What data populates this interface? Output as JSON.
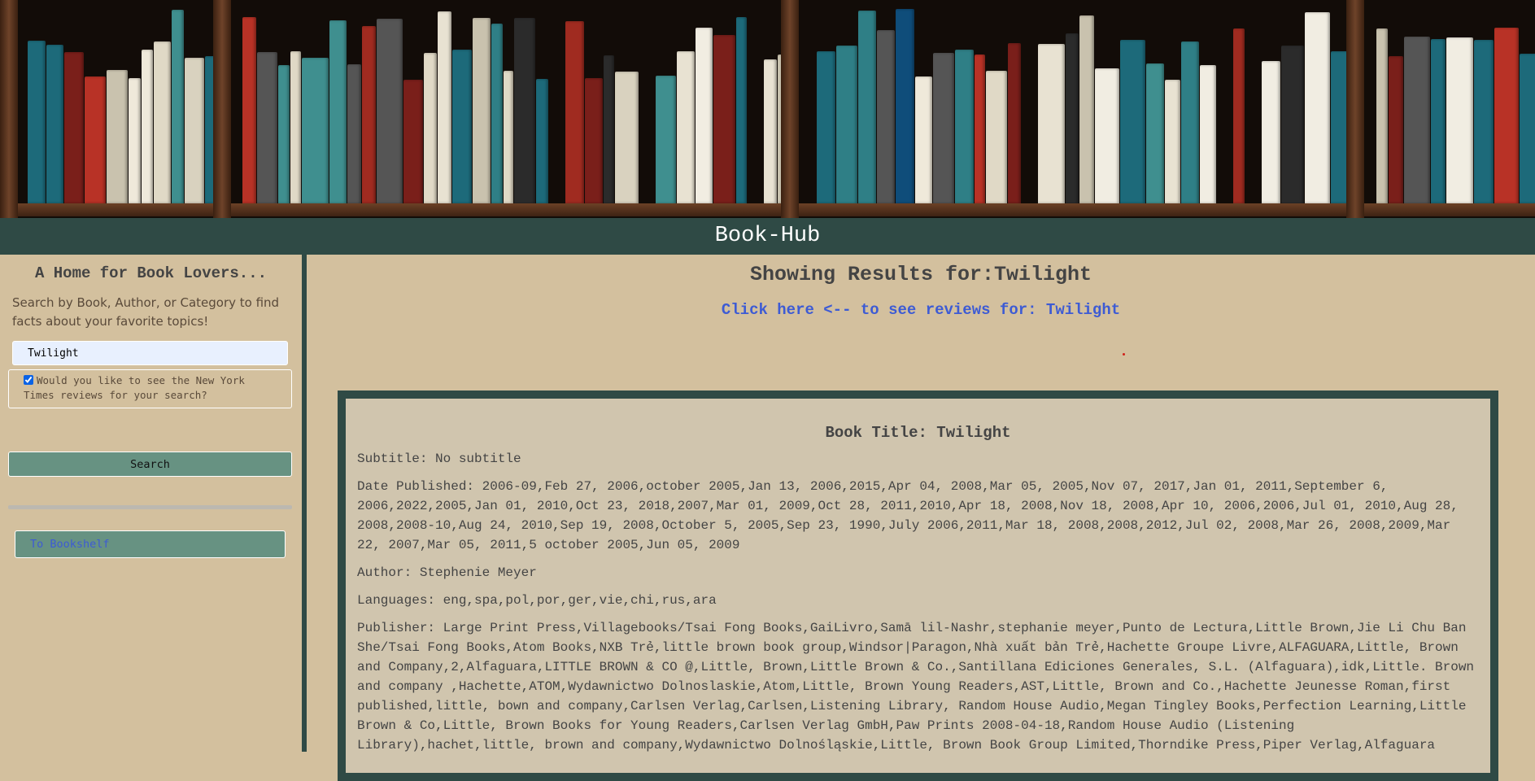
{
  "header": {
    "title": "Book-Hub"
  },
  "sidebar": {
    "heading": "A Home for Book Lovers...",
    "intro": "Search by Book, Author, or Category to find facts about your favorite topics!",
    "search_value": "Twilight",
    "nyt_checkbox_checked": true,
    "nyt_checkbox_label": "Would you like to see the New York Times reviews for your search?",
    "search_button": "Search",
    "bookshelf_link": "To Bookshelf"
  },
  "main": {
    "results_title": "Showing Results for:Twilight",
    "reviews_link": "Click here <-- to see reviews for: Twilight",
    "book": {
      "title": "Book Title: Twilight",
      "subtitle": "Subtitle: No subtitle",
      "date_published": "Date Published: 2006-09,Feb 27, 2006,october 2005,Jan 13, 2006,2015,Apr 04, 2008,Mar 05, 2005,Nov 07, 2017,Jan 01, 2011,September 6, 2006,2022,2005,Jan 01, 2010,Oct 23, 2018,2007,Mar 01, 2009,Oct 28, 2011,2010,Apr 18, 2008,Nov 18, 2008,Apr 10, 2006,2006,Jul 01, 2010,Aug 28, 2008,2008-10,Aug 24, 2010,Sep 19, 2008,October 5, 2005,Sep 23, 1990,July 2006,2011,Mar 18, 2008,2008,2012,Jul 02, 2008,Mar 26, 2008,2009,Mar 22, 2007,Mar 05, 2011,5 october 2005,Jun 05, 2009",
      "author": "Author: Stephenie Meyer",
      "languages": "Languages: eng,spa,pol,por,ger,vie,chi,rus,ara",
      "publisher": "Publisher: Large Print Press,Villagebooks/Tsai Fong Books,GaiLivro,Samā lil-Nashr,stephanie meyer,Punto de Lectura,Little Brown,Jie Li Chu Ban She/Tsai Fong Books,Atom Books,NXB Trẻ,little brown book group,Windsor|Paragon,Nhà xuất bản Trẻ,Hachette Groupe Livre,ALFAGUARA,Little, Brown and Company,2,Alfaguara,LITTLE BROWN & CO @,Little, Brown,Little Brown & Co.,Santillana Ediciones Generales, S.L. (Alfaguara),idk,Little. Brown and company ,Hachette,ATOM,Wydawnictwo Dolnoslaskie,Atom,Little, Brown Young Readers,AST,Little, Brown and Co.,Hachette Jeunesse Roman,first published,little, bown and company,Carlsen Verlag,Carlsen,Listening Library, Random House Audio,Megan Tingley Books,Perfection Learning,Little Brown & Co,Little, Brown Books for Young Readers,Carlsen Verlag GmbH,Paw Prints 2008-04-18,Random House Audio (Listening Library),hachet,little, brown and company,Wydawnictwo Dolnośląskie,Little, Brown Book Group Limited,Thorndike Press,Piper Verlag,Alfaguara"
    }
  },
  "colors": {
    "header_bg": "#2f4a45",
    "page_bg": "#d3c09e",
    "card_bg": "#d0c5ae",
    "button_bg": "#679282",
    "link": "#3d5bd4"
  }
}
